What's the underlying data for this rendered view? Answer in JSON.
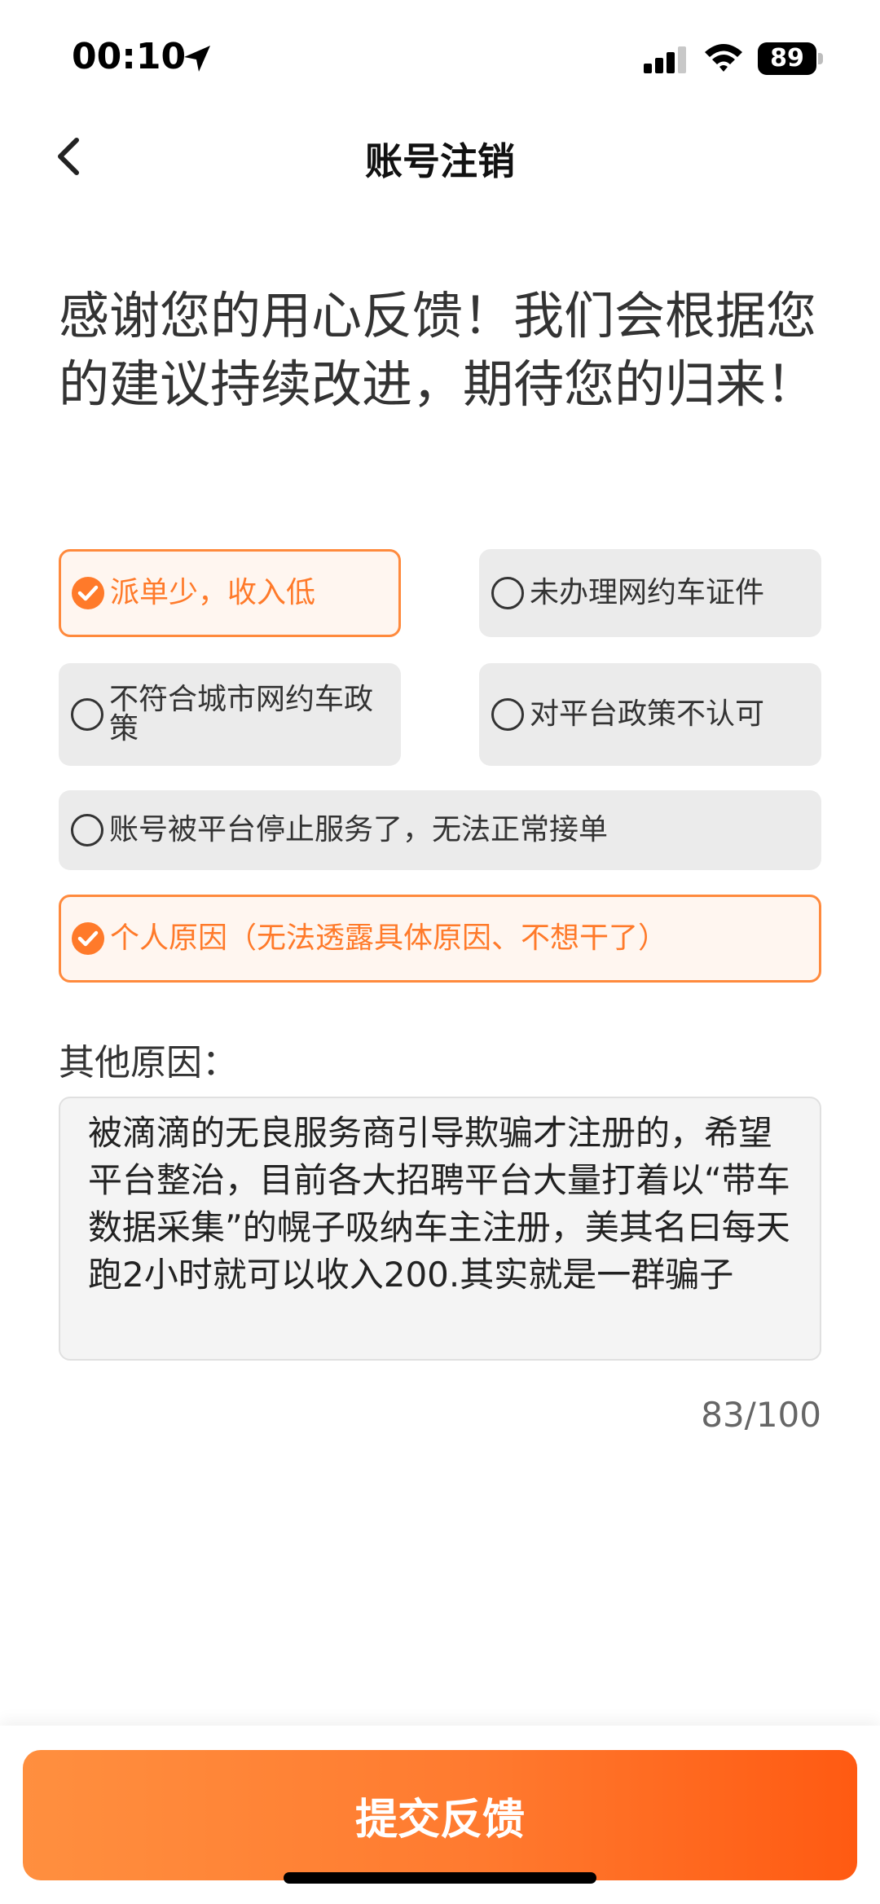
{
  "status_bar": {
    "time": "00:10",
    "battery": "89",
    "icons": [
      "location-arrow-icon",
      "signal-icon",
      "wifi-icon",
      "battery-icon"
    ]
  },
  "nav": {
    "title": "账号注销",
    "back_icon": "chevron-left-icon"
  },
  "thanks_message": "感谢您的用心反馈！我们会根据您的建议持续改进，期待您的归来！",
  "options": [
    {
      "label": "派单少，收入低",
      "selected": true
    },
    {
      "label": "未办理网约车证件",
      "selected": false
    },
    {
      "label": "不符合城市网约车政策",
      "selected": false
    },
    {
      "label": "对平台政策不认可",
      "selected": false
    },
    {
      "label": "账号被平台停止服务了，无法正常接单",
      "selected": false
    },
    {
      "label": "个人原因（无法透露具体原因、不想干了）",
      "selected": true
    }
  ],
  "other_reason": {
    "label": "其他原因：",
    "value": "被滴滴的无良服务商引导欺骗才注册的，希望平台整治，目前各大招聘平台大量打着以“带车数据采集”的幌子吸纳车主注册，美其名曰每天跑2小时就可以收入200.其实就是一群骗子",
    "counter": "83/100"
  },
  "submit_label": "提交反馈",
  "colors": {
    "accent": "#ff7a2a",
    "selected_bg": "#fff6f0",
    "option_bg": "#ebebeb"
  }
}
